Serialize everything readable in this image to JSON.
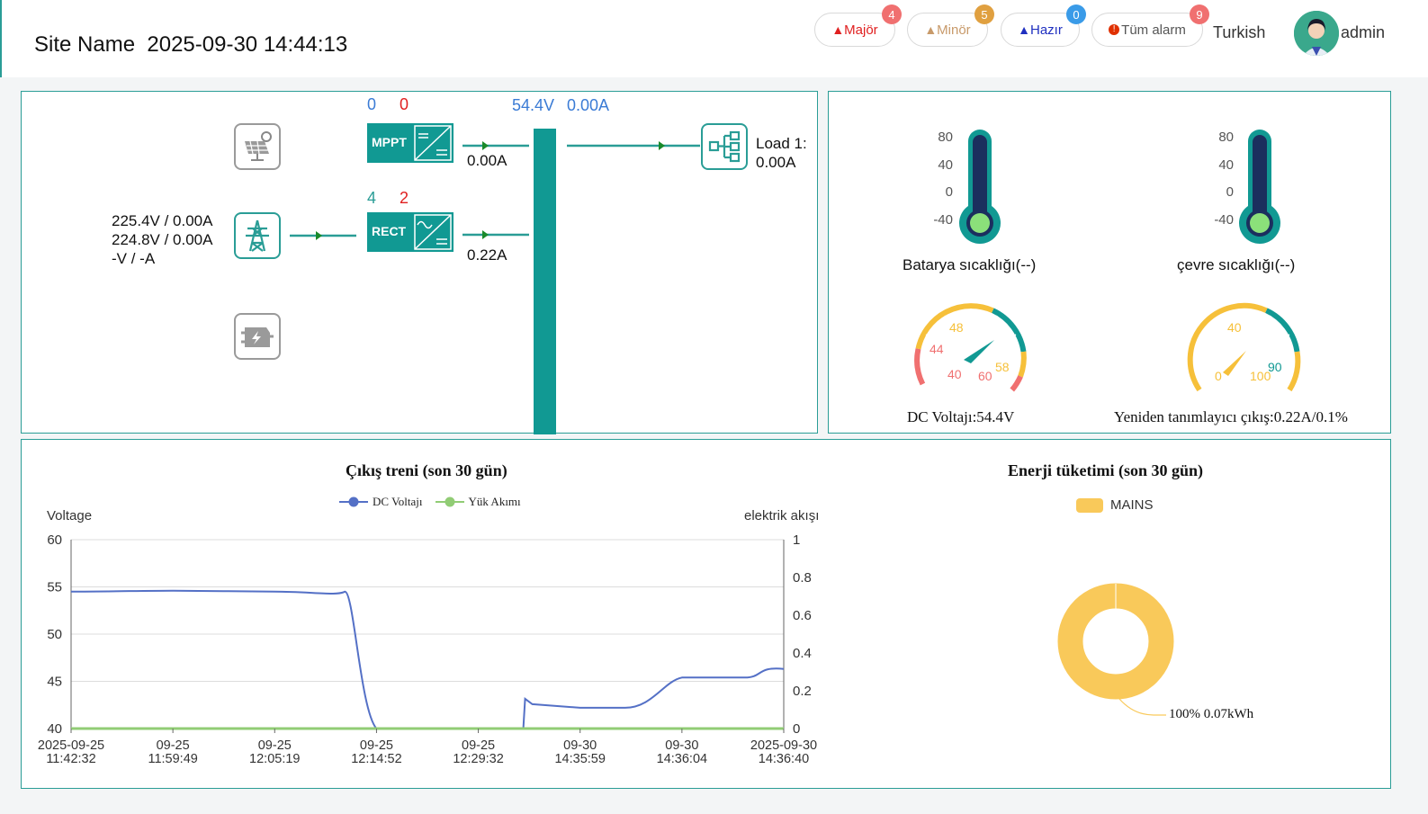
{
  "header": {
    "site_name": "Site Name",
    "datetime": "2025-09-30 14:44:13",
    "alarms": [
      {
        "label": "Majör",
        "count": "4",
        "color": "#e02020",
        "badge": "#f07070"
      },
      {
        "label": "Minör",
        "count": "5",
        "color": "#c89a6a",
        "badge": "#e0a040"
      },
      {
        "label": "Hazır",
        "count": "0",
        "color": "#2030c0",
        "badge": "#3a9be8"
      },
      {
        "label": "Tüm alarm",
        "count": "9",
        "color": "#e03000",
        "badge": "#f07070"
      }
    ],
    "language": "Turkish",
    "user": "admin"
  },
  "power_flow": {
    "mppt": {
      "label": "MPPT",
      "count_blue": "0",
      "count_red": "0",
      "current": "0.00A"
    },
    "rect": {
      "label": "RECT",
      "count_blue": "4",
      "count_red": "2",
      "current": "0.22A"
    },
    "bus": {
      "voltage": "54.4V",
      "current": "0.00A"
    },
    "load": {
      "label": "Load 1:",
      "current": "0.00A"
    },
    "mains": {
      "line1": "225.4V / 0.00A",
      "line2": "224.8V / 0.00A",
      "line3": "-V / -A"
    }
  },
  "sensors": {
    "battery_temp": {
      "label": "Batarya sıcaklığı(--)",
      "ticks": [
        "80",
        "40",
        "0",
        "-40"
      ]
    },
    "env_temp": {
      "label": "çevre sıcaklığı(--)",
      "ticks": [
        "80",
        "40",
        "0",
        "-40"
      ]
    },
    "dc_voltage": {
      "label": "DC Voltajı:54.4V",
      "ticks": [
        "40",
        "44",
        "48",
        "58",
        "60"
      ],
      "value": 54.4
    },
    "rectifier": {
      "label": "Yeniden tanımlayıcı çıkış:0.22A/0.1%",
      "ticks": [
        "0",
        "40",
        "90",
        "100"
      ],
      "value": 0.1
    }
  },
  "trend_chart": {
    "title": "Çıkış treni (son 30 gün)",
    "legend": [
      "DC Voltajı",
      "Yük Akımı"
    ],
    "y_left_label": "Voltage",
    "y_right_label": "elektrik akışı",
    "y_left_ticks": [
      "60",
      "55",
      "50",
      "45",
      "40"
    ],
    "y_right_ticks": [
      "1",
      "0.8",
      "0.6",
      "0.4",
      "0.2",
      "0"
    ],
    "x_ticks": [
      [
        "2025-09-25",
        "11:42:32"
      ],
      [
        "09-25",
        "11:59:49"
      ],
      [
        "09-25",
        "12:05:19"
      ],
      [
        "09-25",
        "12:14:52"
      ],
      [
        "09-25",
        "12:29:32"
      ],
      [
        "09-30",
        "14:35:59"
      ],
      [
        "09-30",
        "14:36:04"
      ],
      [
        "2025-09-30",
        "14:36:40"
      ]
    ],
    "series_colors": [
      "#5470c6",
      "#91cc75"
    ]
  },
  "energy_chart": {
    "title": "Enerji tüketimi (son 30 gün)",
    "legend": "MAINS",
    "label": "100% 0.07kWh",
    "color": "#f9c95a"
  },
  "chart_data": [
    {
      "type": "line",
      "title": "Çıkış treni (son 30 gün)",
      "ylabel": "Voltage",
      "ylabel_right": "elektrik akışı",
      "ylim": [
        40,
        60
      ],
      "ylim_right": [
        0,
        1
      ],
      "x": [
        "2025-09-25 11:42:32",
        "09-25 11:59:49",
        "09-25 12:05:19",
        "09-25 12:14:52",
        "09-25 12:29:32",
        "09-30 14:35:59",
        "09-30 14:36:04",
        "2025-09-30 14:36:40"
      ],
      "series": [
        {
          "name": "DC Voltajı",
          "values": [
            54.5,
            54.6,
            54.5,
            40.0,
            40.0,
            42.2,
            45.4,
            46.6
          ]
        },
        {
          "name": "Yük Akımı",
          "values": [
            0,
            0,
            0,
            0,
            0,
            0,
            0,
            0
          ]
        }
      ]
    },
    {
      "type": "pie",
      "title": "Enerji tüketimi (son 30 gün)",
      "categories": [
        "MAINS"
      ],
      "values": [
        100
      ],
      "labels": [
        "100% 0.07kWh"
      ]
    }
  ]
}
